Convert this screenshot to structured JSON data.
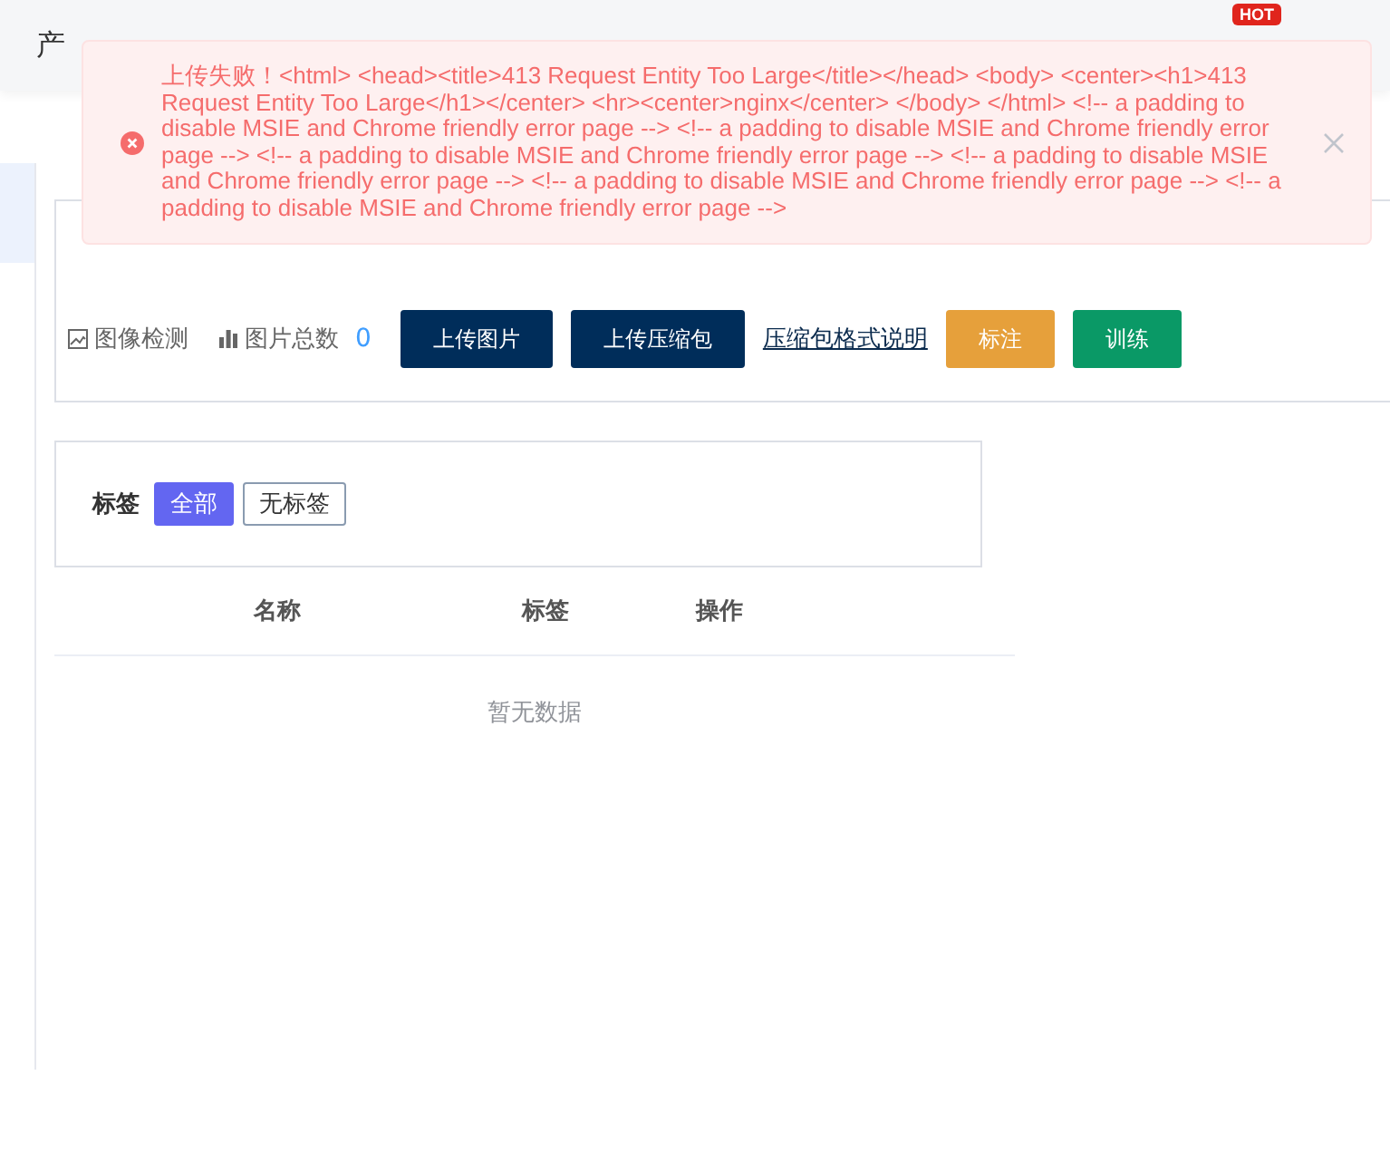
{
  "nav": {
    "items": [
      "产"
    ],
    "badge": "HOT"
  },
  "toast": {
    "kind": "error",
    "message": "上传失败！<html> <head><title>413 Request Entity Too Large</title></head> <body> <center><h1>413 Request Entity Too Large</h1></center> <hr><center>nginx</center> </body> </html> <!-- a padding to disable MSIE and Chrome friendly error page --> <!-- a padding to disable MSIE and Chrome friendly error page --> <!-- a padding to disable MSIE and Chrome friendly error page --> <!-- a padding to disable MSIE and Chrome friendly error page --> <!-- a padding to disable MSIE and Chrome friendly error page --> <!-- a padding to disable MSIE and Chrome friendly error page -->"
  },
  "project": {
    "type_label": "图像检测",
    "count_label": "图片总数",
    "count": "0",
    "actions": [
      {
        "label": "上传图片",
        "kind": "primary"
      },
      {
        "label": "上传压缩包",
        "kind": "primary"
      },
      {
        "label": "压缩包格式说明",
        "kind": "link"
      },
      {
        "label": "标注",
        "kind": "warning"
      },
      {
        "label": "训练",
        "kind": "success"
      }
    ]
  },
  "filter": {
    "label": "标签",
    "tags": [
      {
        "label": "全部",
        "selected": true
      },
      {
        "label": "无标签",
        "selected": false
      }
    ]
  },
  "table": {
    "columns": [
      "名称",
      "标签",
      "操作"
    ],
    "empty_text": "暂无数据"
  }
}
